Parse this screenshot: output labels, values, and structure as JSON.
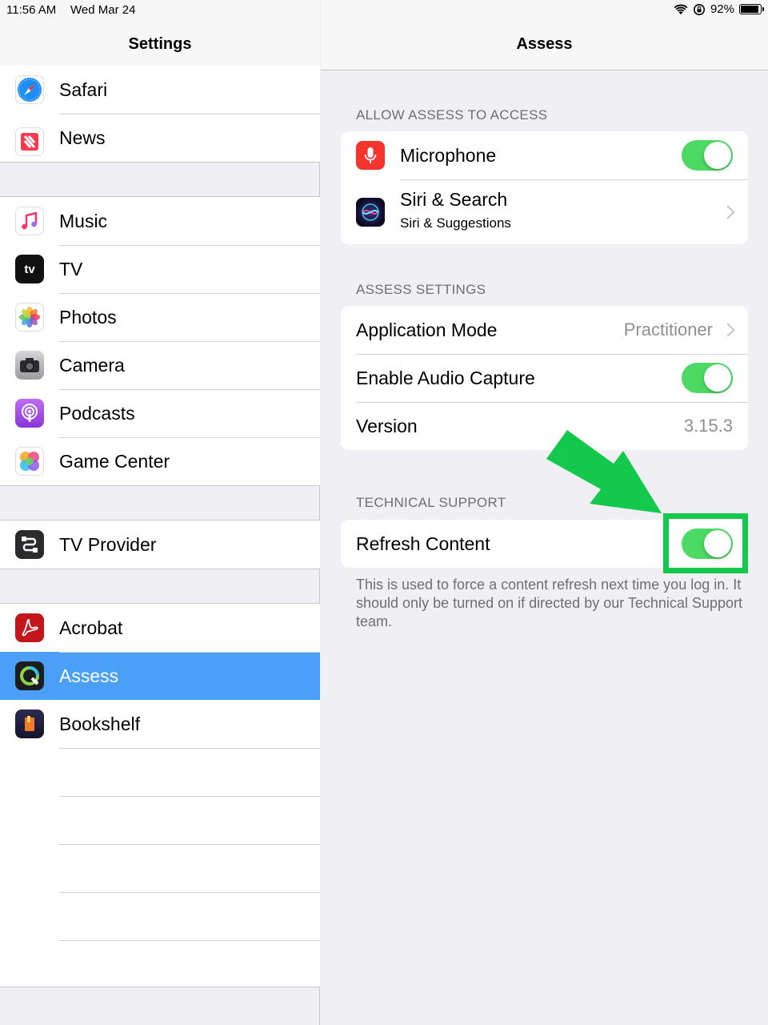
{
  "status_bar": {
    "time": "11:56 AM",
    "date": "Wed Mar 24",
    "battery": "92%",
    "battery_level": 0.92
  },
  "sidebar": {
    "title": "Settings",
    "groups": [
      [
        {
          "label": "Safari",
          "icon": "safari-icon"
        },
        {
          "label": "News",
          "icon": "news-icon"
        }
      ],
      [
        {
          "label": "Music",
          "icon": "music-icon"
        },
        {
          "label": "TV",
          "icon": "tv-icon"
        },
        {
          "label": "Photos",
          "icon": "photos-icon"
        },
        {
          "label": "Camera",
          "icon": "camera-icon"
        },
        {
          "label": "Podcasts",
          "icon": "podcasts-icon"
        },
        {
          "label": "Game Center",
          "icon": "game-center-icon"
        }
      ],
      [
        {
          "label": "TV Provider",
          "icon": "tv-provider-icon"
        }
      ],
      [
        {
          "label": "Acrobat",
          "icon": "acrobat-icon"
        },
        {
          "label": "Assess",
          "icon": "assess-icon",
          "selected": true
        },
        {
          "label": "Bookshelf",
          "icon": "bookshelf-icon"
        }
      ]
    ],
    "tv_icon_text": "tv"
  },
  "main": {
    "title": "Assess",
    "sections": {
      "access": {
        "title": "ALLOW ASSESS TO ACCESS",
        "microphone": {
          "label": "Microphone",
          "on": true
        },
        "siri": {
          "label": "Siri & Search",
          "sublabel": "Siri & Suggestions"
        }
      },
      "settings": {
        "title": "ASSESS SETTINGS",
        "app_mode": {
          "label": "Application Mode",
          "value": "Practitioner"
        },
        "audio": {
          "label": "Enable Audio Capture",
          "on": true
        },
        "version": {
          "label": "Version",
          "value": "3.15.3"
        }
      },
      "support": {
        "title": "TECHNICAL SUPPORT",
        "refresh": {
          "label": "Refresh Content",
          "on": true
        },
        "footnote": "This is used to force a content refresh next time you log in. It should only be turned on if directed by our Technical Support team."
      }
    }
  },
  "colors": {
    "toggle_on": "#4cd964",
    "selected_row": "#4aa0f7",
    "annotation_green": "#13c84b"
  }
}
